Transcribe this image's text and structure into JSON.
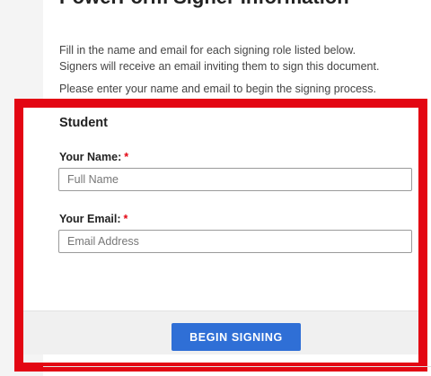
{
  "header": {
    "title": "PowerForm Signer Information"
  },
  "intro": {
    "line1": "Fill in the name and email for each signing role listed below.",
    "line2": "Signers will receive an email inviting them to sign this document.",
    "prompt": "Please enter your name and email to begin the signing process."
  },
  "role": {
    "title": "Student",
    "name_label": "Your Name:",
    "name_placeholder": "Full Name",
    "name_value": "",
    "email_label": "Your Email:",
    "email_placeholder": "Email Address",
    "email_value": "",
    "required_marker": "*"
  },
  "actions": {
    "begin_label": "BEGIN SIGNING"
  },
  "colors": {
    "highlight": "#e30613",
    "button": "#2f6fd6",
    "required": "#e30613"
  }
}
